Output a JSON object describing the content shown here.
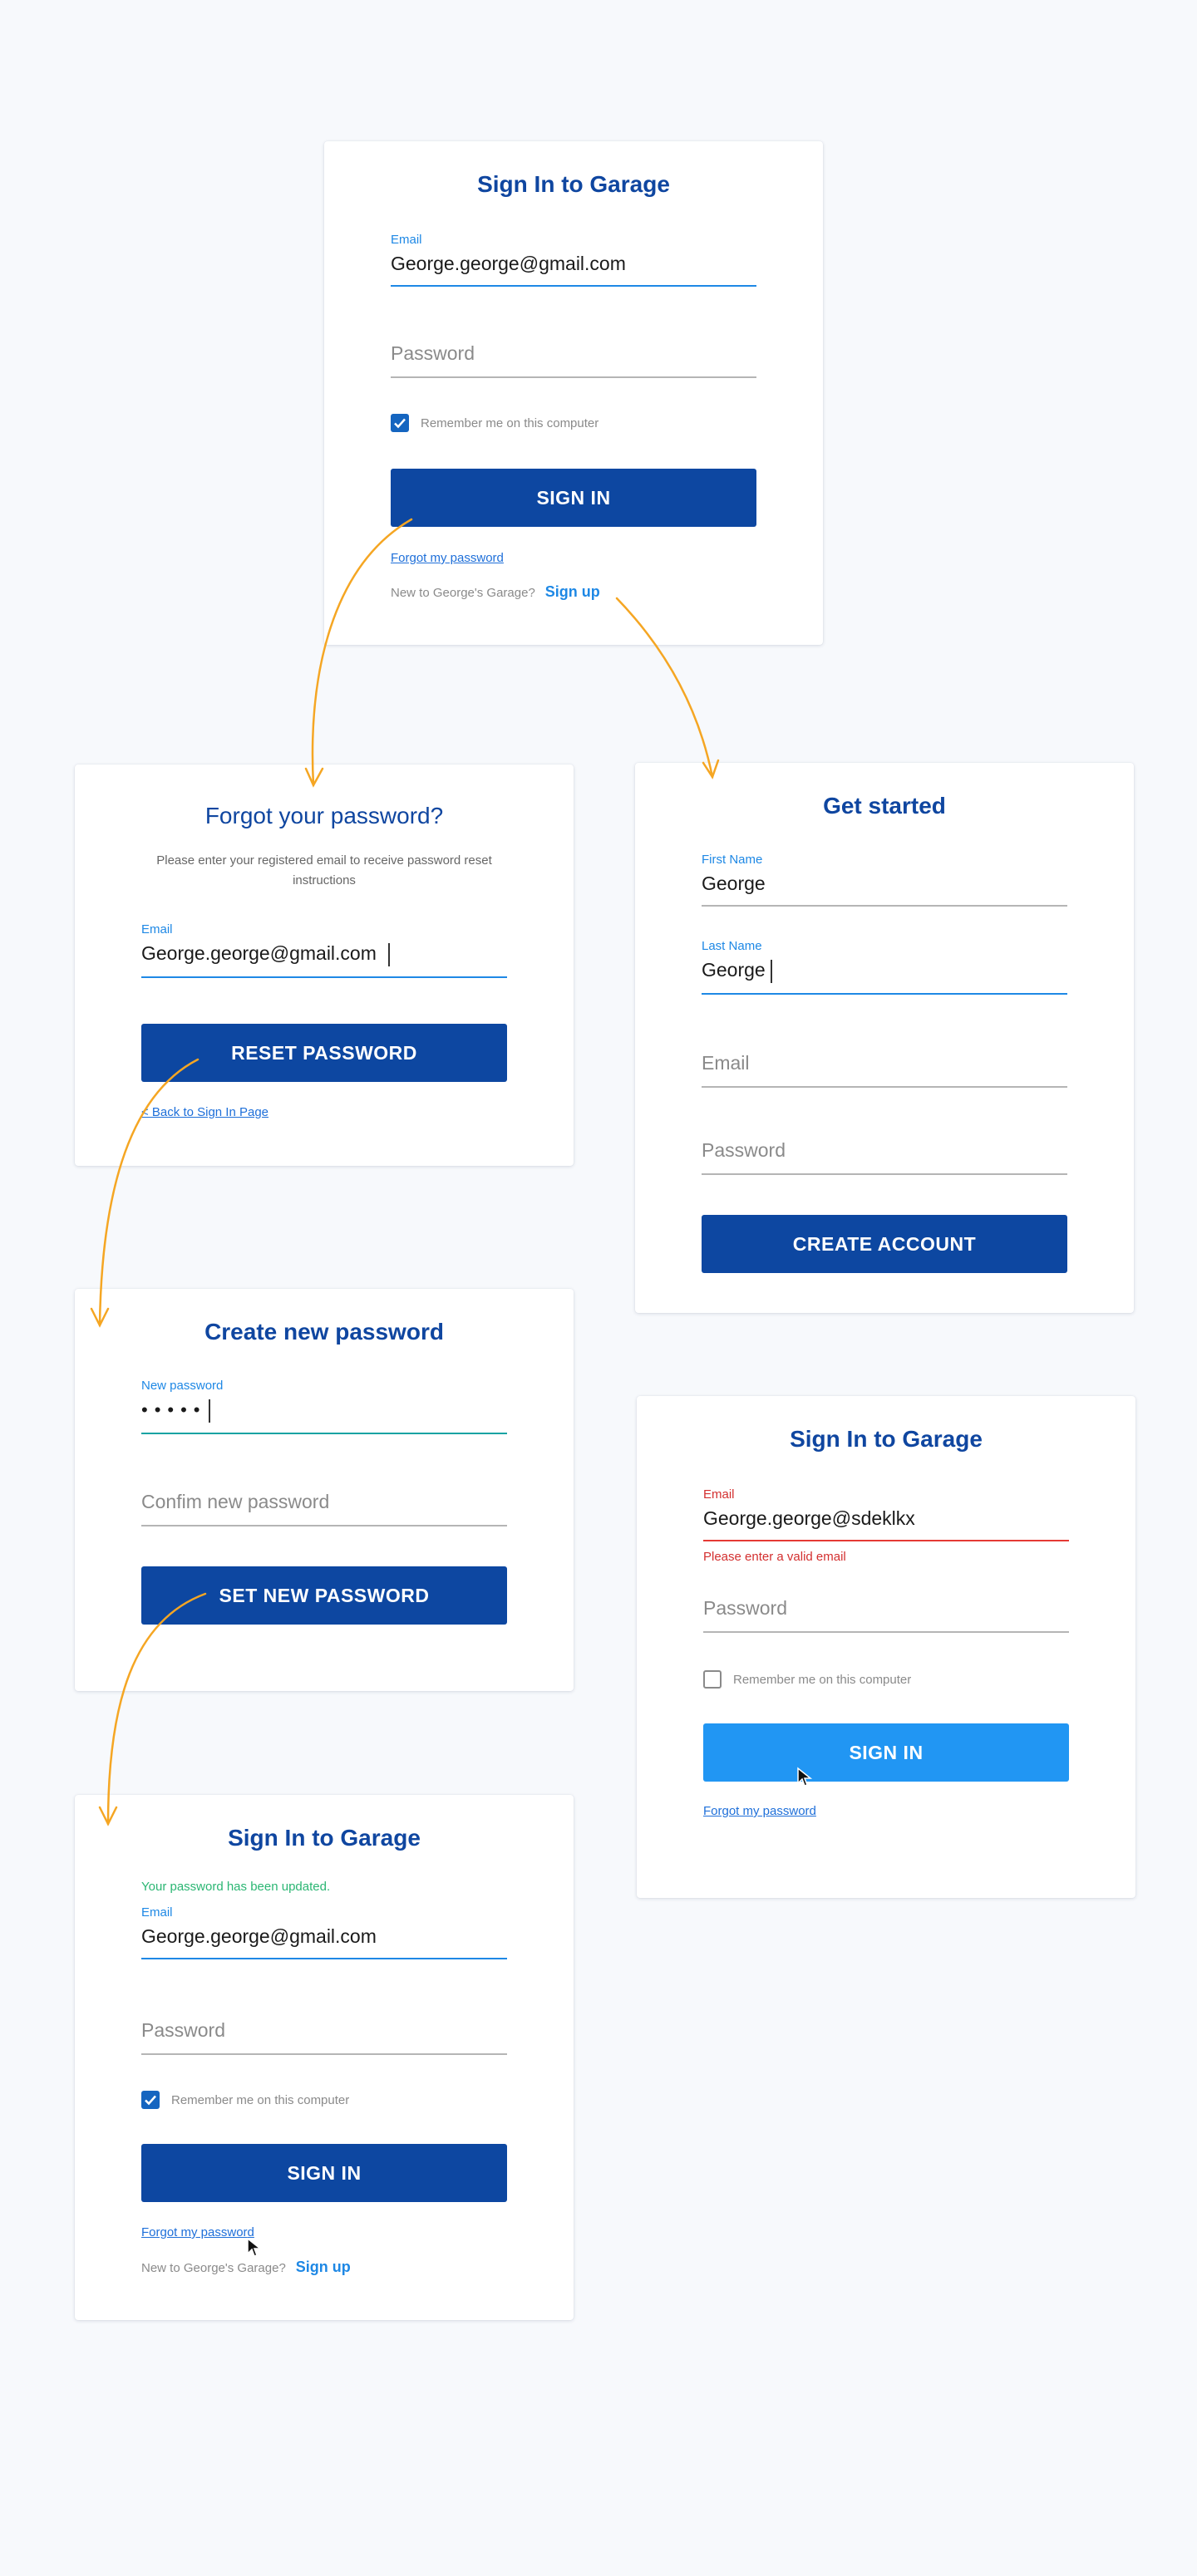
{
  "signin_1": {
    "title": "Sign In to Garage",
    "email_label": "Email",
    "email_value": "George.george@gmail.com",
    "password_placeholder": "Password",
    "remember_label": "Remember me on this computer",
    "remember_checked": true,
    "signin_button": "SIGN IN",
    "forgot_link": "Forgot my password",
    "new_prompt": "New to George's Garage?",
    "signup_link": "Sign up"
  },
  "forgot": {
    "title": "Forgot your password?",
    "subtitle": "Please enter your registered email to receive password reset instructions",
    "email_label": "Email",
    "email_value": "George.george@gmail.com",
    "reset_button": "RESET PASSWORD",
    "back_link": "< Back to Sign In Page"
  },
  "get_started": {
    "title": "Get started",
    "first_name_label": "First Name",
    "first_name_value": "George",
    "last_name_label": "Last Name",
    "last_name_value": "George",
    "email_placeholder": "Email",
    "password_placeholder": "Password",
    "create_button": "CREATE ACCOUNT"
  },
  "new_password": {
    "title": "Create new password",
    "new_label": "New password",
    "new_value": "•••••",
    "confirm_placeholder": "Confim new password",
    "set_button": "SET NEW PASSWORD"
  },
  "signin_error": {
    "title": "Sign In to Garage",
    "email_label": "Email",
    "email_value": "George.george@sdeklkx",
    "error_text": "Please enter a valid email",
    "password_placeholder": "Password",
    "remember_label": "Remember me on this computer",
    "remember_checked": false,
    "signin_button": "SIGN IN",
    "forgot_link": "Forgot my password"
  },
  "signin_updated": {
    "title": "Sign In to Garage",
    "success_text": "Your password has been updated.",
    "email_label": "Email",
    "email_value": "George.george@gmail.com",
    "password_placeholder": "Password",
    "remember_label": "Remember me on this computer",
    "remember_checked": true,
    "signin_button": "SIGN IN",
    "forgot_link": "Forgot my password",
    "new_prompt": "New to George's Garage?",
    "signup_link": "Sign up"
  },
  "colors": {
    "brand_blue": "#0d47a1",
    "accent_blue": "#1e88e5",
    "light_button": "#2196f3",
    "error_red": "#d32f2f",
    "success_green": "#2bb673",
    "flow_arrow": "#f5a623"
  }
}
